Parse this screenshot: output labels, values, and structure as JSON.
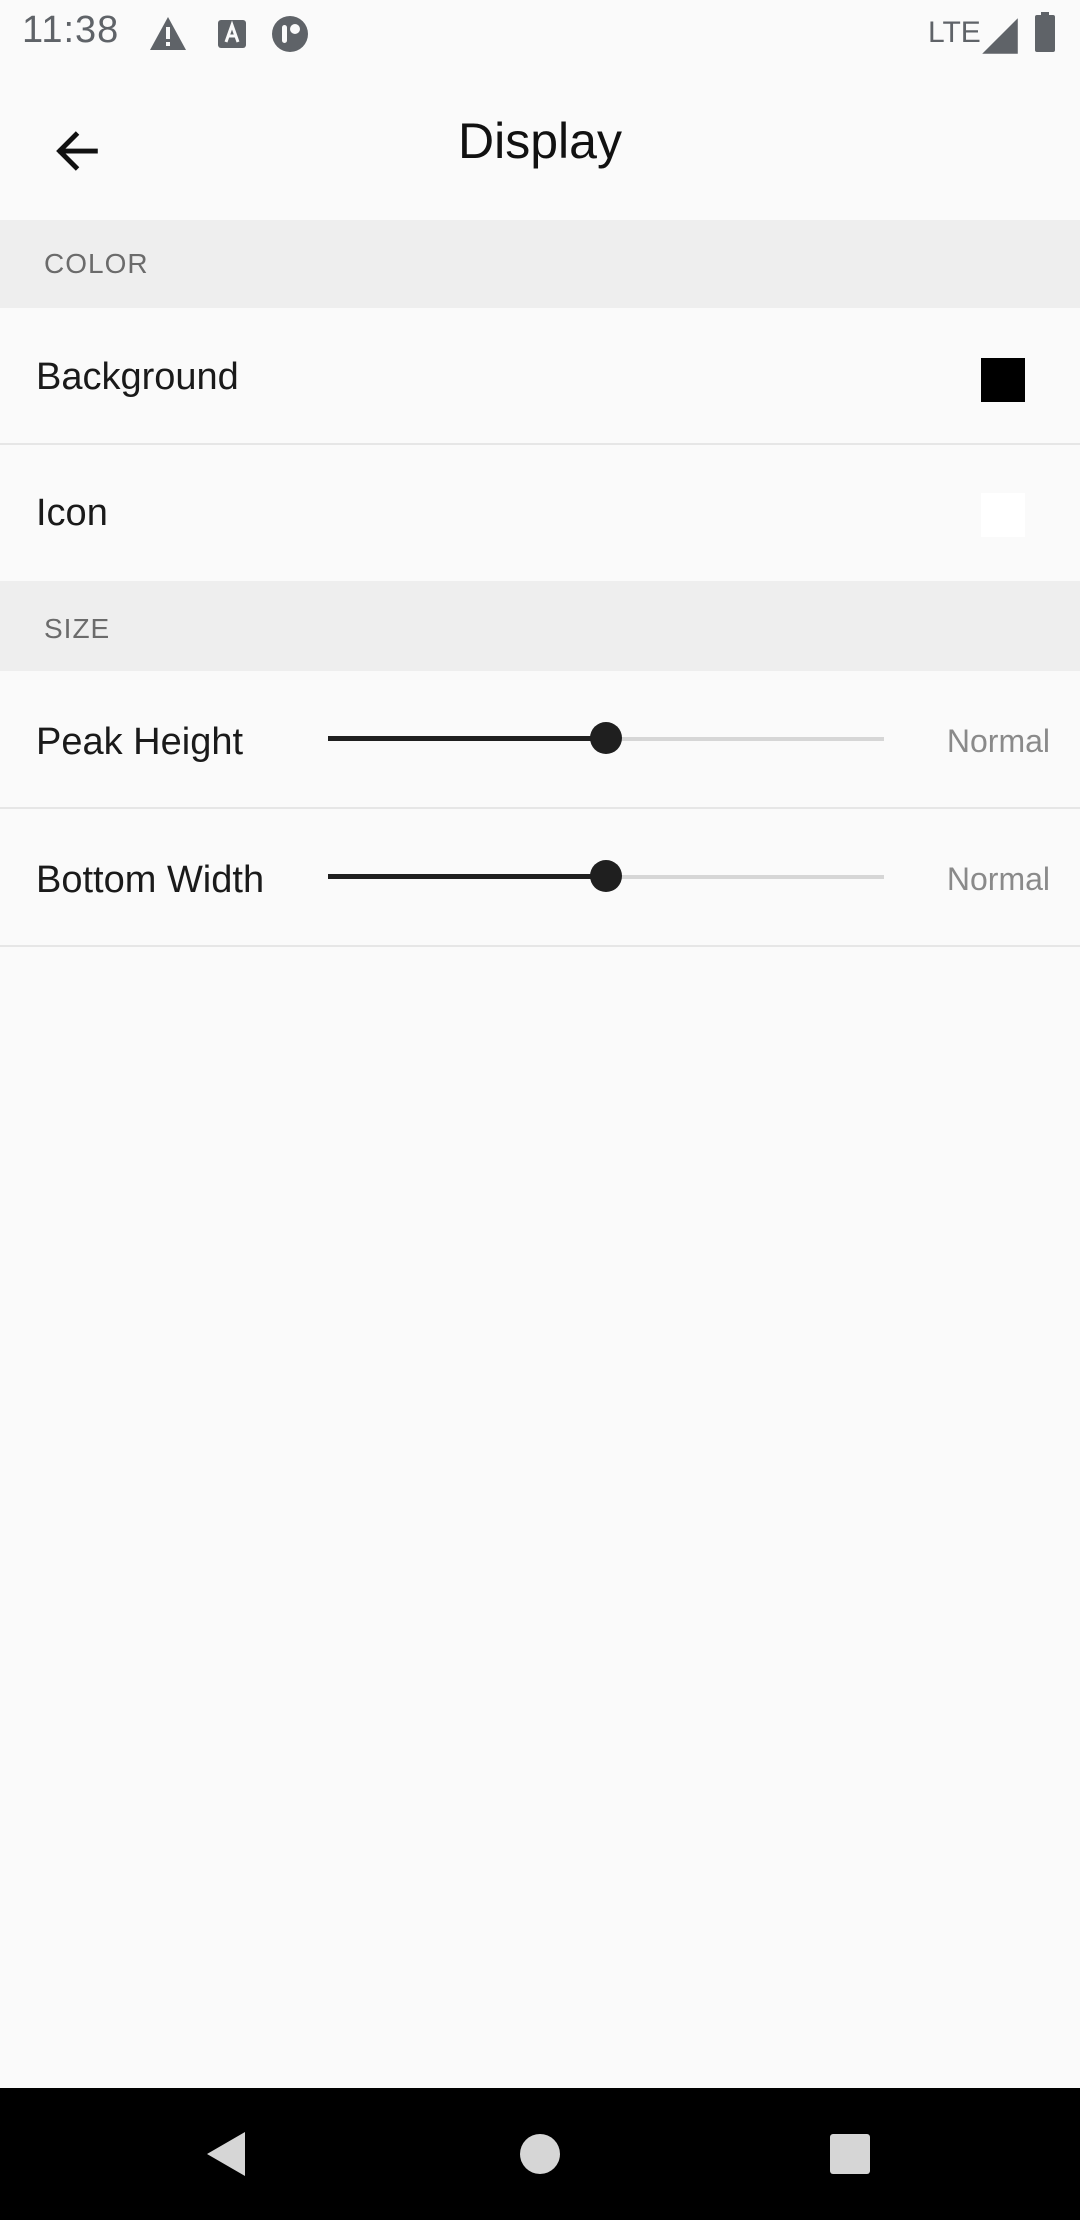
{
  "status_bar": {
    "time": "11:38",
    "network": "LTE",
    "icons": [
      "warning-icon",
      "text-a-icon",
      "app-logo-icon",
      "signal-icon",
      "battery-icon"
    ]
  },
  "app_bar": {
    "title": "Display",
    "back_icon": "arrow-back-icon"
  },
  "sections": {
    "color": {
      "header": "COLOR",
      "items": [
        {
          "label": "Background",
          "swatch_color": "#000000"
        },
        {
          "label": "Icon",
          "swatch_color": "#ffffff"
        }
      ]
    },
    "size": {
      "header": "SIZE",
      "items": [
        {
          "label": "Peak Height",
          "value": "Normal",
          "level": 0.5
        },
        {
          "label": "Bottom Width",
          "value": "Normal",
          "level": 0.5
        }
      ]
    }
  },
  "nav_bar": {
    "back": "nav-back-icon",
    "home": "nav-home-icon",
    "recents": "nav-recents-icon"
  },
  "colors": {
    "accent": "#1f1f1f",
    "section_background": "#eeeeee",
    "page_background": "#fafafa"
  }
}
